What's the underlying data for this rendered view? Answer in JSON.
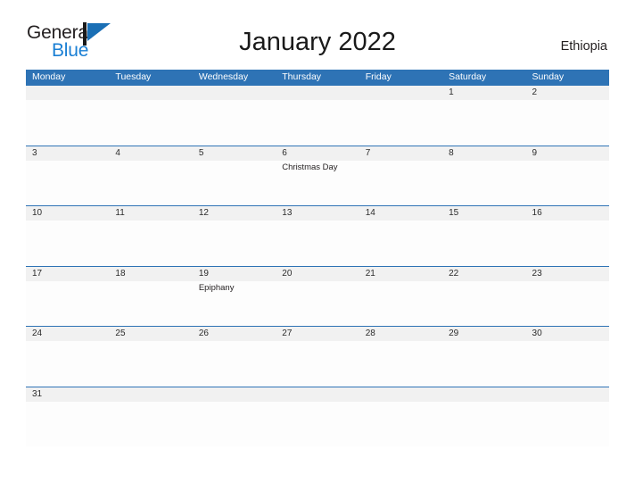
{
  "brand": {
    "name_part1": "General",
    "name_part2": "Blue",
    "flag_icon": "blue-flag-triangle-icon",
    "color_dark": "#231f20",
    "color_blue": "#1a7fd4"
  },
  "header": {
    "title": "January 2022",
    "country": "Ethiopia"
  },
  "colors": {
    "header_blue": "#2e73b5",
    "band_gray": "#f1f1f1",
    "rule_blue": "#2e73b5",
    "text": "#231f20"
  },
  "calendar": {
    "weekdays": [
      "Monday",
      "Tuesday",
      "Wednesday",
      "Thursday",
      "Friday",
      "Saturday",
      "Sunday"
    ],
    "weeks": [
      [
        {
          "day": "",
          "event": ""
        },
        {
          "day": "",
          "event": ""
        },
        {
          "day": "",
          "event": ""
        },
        {
          "day": "",
          "event": ""
        },
        {
          "day": "",
          "event": ""
        },
        {
          "day": "1",
          "event": ""
        },
        {
          "day": "2",
          "event": ""
        }
      ],
      [
        {
          "day": "3",
          "event": ""
        },
        {
          "day": "4",
          "event": ""
        },
        {
          "day": "5",
          "event": ""
        },
        {
          "day": "6",
          "event": "Christmas Day"
        },
        {
          "day": "7",
          "event": ""
        },
        {
          "day": "8",
          "event": ""
        },
        {
          "day": "9",
          "event": ""
        }
      ],
      [
        {
          "day": "10",
          "event": ""
        },
        {
          "day": "11",
          "event": ""
        },
        {
          "day": "12",
          "event": ""
        },
        {
          "day": "13",
          "event": ""
        },
        {
          "day": "14",
          "event": ""
        },
        {
          "day": "15",
          "event": ""
        },
        {
          "day": "16",
          "event": ""
        }
      ],
      [
        {
          "day": "17",
          "event": ""
        },
        {
          "day": "18",
          "event": ""
        },
        {
          "day": "19",
          "event": "Epiphany"
        },
        {
          "day": "20",
          "event": ""
        },
        {
          "day": "21",
          "event": ""
        },
        {
          "day": "22",
          "event": ""
        },
        {
          "day": "23",
          "event": ""
        }
      ],
      [
        {
          "day": "24",
          "event": ""
        },
        {
          "day": "25",
          "event": ""
        },
        {
          "day": "26",
          "event": ""
        },
        {
          "day": "27",
          "event": ""
        },
        {
          "day": "28",
          "event": ""
        },
        {
          "day": "29",
          "event": ""
        },
        {
          "day": "30",
          "event": ""
        }
      ],
      [
        {
          "day": "31",
          "event": ""
        },
        {
          "day": "",
          "event": ""
        },
        {
          "day": "",
          "event": ""
        },
        {
          "day": "",
          "event": ""
        },
        {
          "day": "",
          "event": ""
        },
        {
          "day": "",
          "event": ""
        },
        {
          "day": "",
          "event": ""
        }
      ]
    ]
  }
}
